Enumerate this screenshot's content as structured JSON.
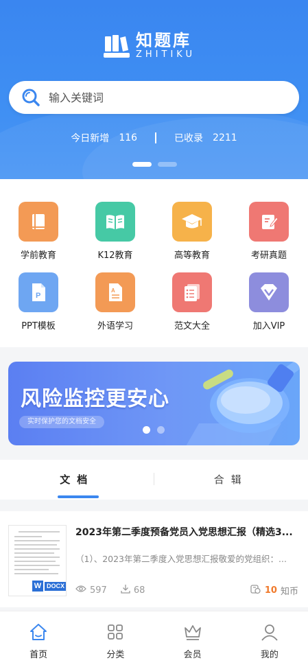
{
  "app": {
    "logo_title": "知题库",
    "logo_subtitle": "ZHITIKU"
  },
  "search": {
    "placeholder": "输入关键词"
  },
  "stats": {
    "today_label": "今日新增",
    "today_value": "116",
    "total_label": "已收录",
    "total_value": "2211"
  },
  "carousel": {
    "count": 2,
    "active_index": 0
  },
  "categories": [
    {
      "label": "学前教育",
      "icon": "book-icon",
      "color": "#f39a55"
    },
    {
      "label": "K12教育",
      "icon": "open-book-icon",
      "color": "#46c9a5"
    },
    {
      "label": "高等教育",
      "icon": "graduation-cap-icon",
      "color": "#f6b24a"
    },
    {
      "label": "考研真题",
      "icon": "edit-document-icon",
      "color": "#ef7873"
    },
    {
      "label": "PPT模板",
      "icon": "ppt-file-icon",
      "color": "#6ea6f2"
    },
    {
      "label": "外语学习",
      "icon": "language-document-icon",
      "color": "#f39a55"
    },
    {
      "label": "范文大全",
      "icon": "article-list-icon",
      "color": "#ef7873"
    },
    {
      "label": "加入VIP",
      "icon": "vip-diamond-icon",
      "color": "#8d8ddd"
    }
  ],
  "banner": {
    "title": "风险监控更安心",
    "subtitle": "实时保护您的文档安全",
    "slides": 2,
    "active_index": 0
  },
  "tabs": [
    {
      "label": "文档",
      "active": true
    },
    {
      "label": "合辑",
      "active": false
    }
  ],
  "document": {
    "title": "2023年第二季度预备党员入党思想汇报（精选3...",
    "snippet": "（1）、2023年第二季度入党思想汇报敬爱的党组织：...",
    "views": "597",
    "downloads": "68",
    "price": "10",
    "price_unit": "知币",
    "file_type": "DOCX",
    "file_type_letter": "W"
  },
  "bottom_nav": [
    {
      "label": "首页",
      "icon": "home-icon",
      "active": true
    },
    {
      "label": "分类",
      "icon": "grid-icon",
      "active": false
    },
    {
      "label": "会员",
      "icon": "crown-icon",
      "active": false
    },
    {
      "label": "我的",
      "icon": "user-icon",
      "active": false
    }
  ],
  "colors": {
    "primary": "#3b87ef",
    "accent": "#f07a2c"
  }
}
